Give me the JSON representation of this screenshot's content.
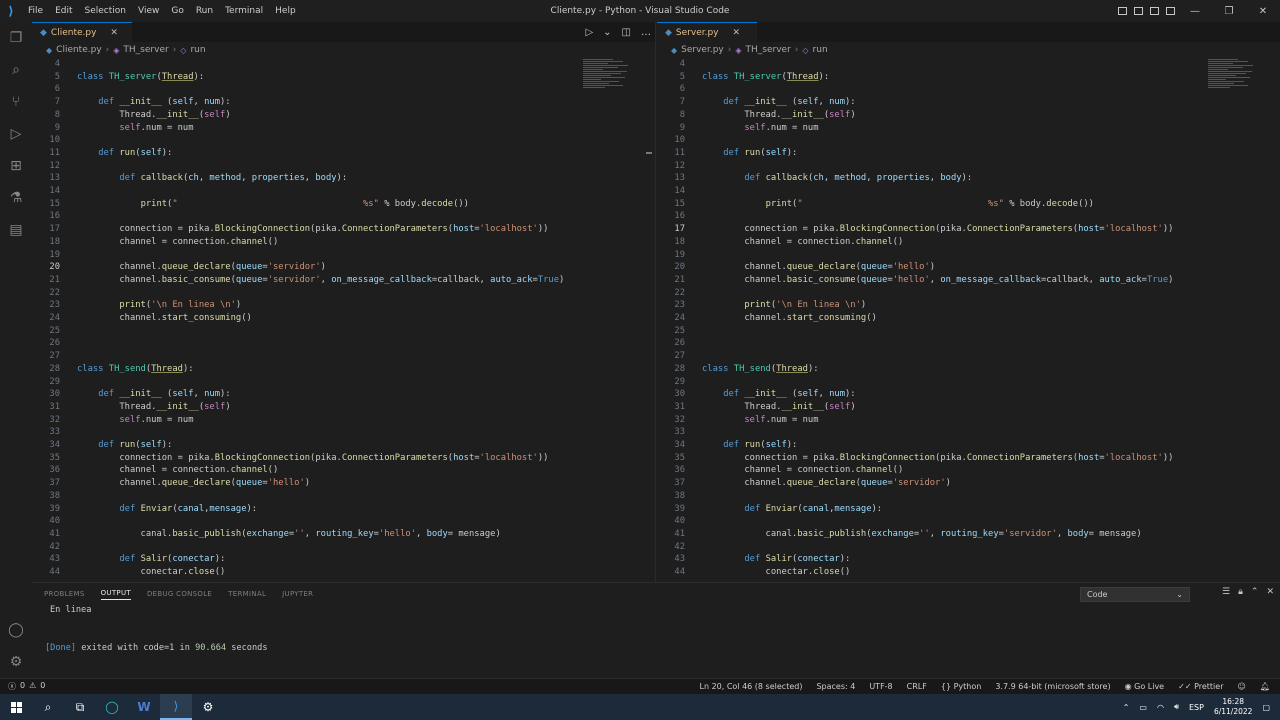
{
  "window": {
    "title": "Cliente.py - Python - Visual Studio Code",
    "menu": [
      "File",
      "Edit",
      "Selection",
      "View",
      "Go",
      "Run",
      "Terminal",
      "Help"
    ]
  },
  "left_editor": {
    "tab": "Cliente.py",
    "breadcrumb": [
      "Cliente.py",
      "TH_server",
      "run"
    ],
    "lines": [
      {
        "n": "4",
        "html": ""
      },
      {
        "n": "5",
        "html": "<span class='kw'>class</span> <span class='cls'>TH_server</span>(<span class='hl-cls'>Thread</span>):"
      },
      {
        "n": "6",
        "html": ""
      },
      {
        "n": "7",
        "html": "    <span class='kw'>def</span> <span class='fn'>__init__</span> (<span class='prm'>self</span>, <span class='prm'>num</span>):"
      },
      {
        "n": "8",
        "html": "        Thread.<span class='fn'>__init__</span>(<span class='slf'>self</span>)"
      },
      {
        "n": "9",
        "html": "        <span class='slf'>self</span>.num = num"
      },
      {
        "n": "10",
        "html": ""
      },
      {
        "n": "11",
        "html": "    <span class='kw'>def</span> <span class='fn'>run</span>(<span class='prm'>self</span>):"
      },
      {
        "n": "12",
        "html": ""
      },
      {
        "n": "13",
        "html": "        <span class='kw'>def</span> <span class='fn'>callback</span>(<span class='prm'>ch</span>, <span class='prm'>method</span>, <span class='prm'>properties</span>, <span class='prm'>body</span>):"
      },
      {
        "n": "14",
        "html": ""
      },
      {
        "n": "15",
        "html": "            <span class='fn'>print</span>(<span class='str'>\"                                   %s\"</span> % body.<span class='fn'>decode</span>())"
      },
      {
        "n": "16",
        "html": ""
      },
      {
        "n": "17",
        "html": "        connection = pika.<span class='fn'>BlockingConnection</span>(pika.<span class='fn'>ConnectionParameters</span>(<span class='prm'>host</span>=<span class='str'>'localhost'</span>))"
      },
      {
        "n": "18",
        "html": "        channel = connection.<span class='fn'>channel</span>()"
      },
      {
        "n": "19",
        "html": ""
      },
      {
        "n": "20",
        "html": "        channel.<span class='fn'>queue_declare</span>(<span class='prm'>queue</span>=<span class='str'>'servidor'</span>)",
        "cur": true
      },
      {
        "n": "21",
        "html": "        channel.<span class='fn'>basic_consume</span>(<span class='prm'>queue</span>=<span class='str'>'servidor'</span>, <span class='prm'>on_message_callback</span>=callback, <span class='prm'>auto_ack</span>=<span class='kw'>True</span>)"
      },
      {
        "n": "22",
        "html": ""
      },
      {
        "n": "23",
        "html": "        <span class='fn'>print</span>(<span class='str'>'\\n En linea \\n'</span>)"
      },
      {
        "n": "24",
        "html": "        channel.<span class='fn'>start_consuming</span>()"
      },
      {
        "n": "25",
        "html": ""
      },
      {
        "n": "26",
        "html": ""
      },
      {
        "n": "27",
        "html": ""
      },
      {
        "n": "28",
        "html": "<span class='kw'>class</span> <span class='cls'>TH_send</span>(<span class='hl-cls'>Thread</span>):"
      },
      {
        "n": "29",
        "html": ""
      },
      {
        "n": "30",
        "html": "    <span class='kw'>def</span> <span class='fn'>__init__</span> (<span class='prm'>self</span>, <span class='prm'>num</span>):"
      },
      {
        "n": "31",
        "html": "        Thread.<span class='fn'>__init__</span>(<span class='slf'>self</span>)"
      },
      {
        "n": "32",
        "html": "        <span class='slf'>self</span>.num = num"
      },
      {
        "n": "33",
        "html": ""
      },
      {
        "n": "34",
        "html": "    <span class='kw'>def</span> <span class='fn'>run</span>(<span class='prm'>self</span>):"
      },
      {
        "n": "35",
        "html": "        connection = pika.<span class='fn'>BlockingConnection</span>(pika.<span class='fn'>ConnectionParameters</span>(<span class='prm'>host</span>=<span class='str'>'localhost'</span>))"
      },
      {
        "n": "36",
        "html": "        channel = connection.<span class='fn'>channel</span>()"
      },
      {
        "n": "37",
        "html": "        channel.<span class='fn'>queue_declare</span>(<span class='prm'>queue</span>=<span class='str'>'hello'</span>)"
      },
      {
        "n": "38",
        "html": ""
      },
      {
        "n": "39",
        "html": "        <span class='kw'>def</span> <span class='fn'>Enviar</span>(<span class='prm'>canal</span>,<span class='prm'>mensage</span>):"
      },
      {
        "n": "40",
        "html": ""
      },
      {
        "n": "41",
        "html": "            canal.<span class='fn'>basic_publish</span>(<span class='prm'>exchange</span>=<span class='str'>''</span>, <span class='prm'>routing_key</span>=<span class='str'>'hello'</span>, <span class='prm'>body</span>= mensage)"
      },
      {
        "n": "42",
        "html": ""
      },
      {
        "n": "43",
        "html": "        <span class='kw'>def</span> <span class='fn'>Salir</span>(<span class='prm'>conectar</span>):"
      },
      {
        "n": "44",
        "html": "            conectar.<span class='fn'>close</span>()"
      }
    ]
  },
  "right_editor": {
    "tab": "Server.py",
    "breadcrumb": [
      "Server.py",
      "TH_server",
      "run"
    ],
    "lines": [
      {
        "n": "4",
        "html": ""
      },
      {
        "n": "5",
        "html": "<span class='kw'>class</span> <span class='cls'>TH_server</span>(<span class='hl-cls'>Thread</span>):"
      },
      {
        "n": "6",
        "html": ""
      },
      {
        "n": "7",
        "html": "    <span class='kw'>def</span> <span class='fn'>__init__</span> (<span class='prm'>self</span>, <span class='prm'>num</span>):"
      },
      {
        "n": "8",
        "html": "        Thread.<span class='fn'>__init__</span>(<span class='slf'>self</span>)"
      },
      {
        "n": "9",
        "html": "        <span class='slf'>self</span>.num = num"
      },
      {
        "n": "10",
        "html": ""
      },
      {
        "n": "11",
        "html": "    <span class='kw'>def</span> <span class='fn'>run</span>(<span class='prm'>self</span>):"
      },
      {
        "n": "12",
        "html": ""
      },
      {
        "n": "13",
        "html": "        <span class='kw'>def</span> <span class='fn'>callback</span>(<span class='prm'>ch</span>, <span class='prm'>method</span>, <span class='prm'>properties</span>, <span class='prm'>body</span>):"
      },
      {
        "n": "14",
        "html": ""
      },
      {
        "n": "15",
        "html": "            <span class='fn'>print</span>(<span class='str'>\"                                   %s\"</span> % body.<span class='fn'>decode</span>())"
      },
      {
        "n": "16",
        "html": ""
      },
      {
        "n": "17",
        "html": "        connection = pika.<span class='fn'>BlockingConnection</span>(pika.<span class='fn'>ConnectionParameters</span>(<span class='prm'>host</span>=<span class='str'>'localhost'</span>))",
        "cur": true
      },
      {
        "n": "18",
        "html": "        channel = connection.<span class='fn'>channel</span>()"
      },
      {
        "n": "19",
        "html": ""
      },
      {
        "n": "20",
        "html": "        channel.<span class='fn'>queue_declare</span>(<span class='prm'>queue</span>=<span class='str'>'hello'</span>)"
      },
      {
        "n": "21",
        "html": "        channel.<span class='fn'>basic_consume</span>(<span class='prm'>queue</span>=<span class='str'>'hello'</span>, <span class='prm'>on_message_callback</span>=callback, <span class='prm'>auto_ack</span>=<span class='kw'>True</span>)"
      },
      {
        "n": "22",
        "html": ""
      },
      {
        "n": "23",
        "html": "        <span class='fn'>print</span>(<span class='str'>'\\n En linea \\n'</span>)"
      },
      {
        "n": "24",
        "html": "        channel.<span class='fn'>start_consuming</span>()"
      },
      {
        "n": "25",
        "html": ""
      },
      {
        "n": "26",
        "html": ""
      },
      {
        "n": "27",
        "html": ""
      },
      {
        "n": "28",
        "html": "<span class='kw'>class</span> <span class='cls'>TH_send</span>(<span class='hl-cls'>Thread</span>):"
      },
      {
        "n": "29",
        "html": ""
      },
      {
        "n": "30",
        "html": "    <span class='kw'>def</span> <span class='fn'>__init__</span> (<span class='prm'>self</span>, <span class='prm'>num</span>):"
      },
      {
        "n": "31",
        "html": "        Thread.<span class='fn'>__init__</span>(<span class='slf'>self</span>)"
      },
      {
        "n": "32",
        "html": "        <span class='slf'>self</span>.num = num"
      },
      {
        "n": "33",
        "html": ""
      },
      {
        "n": "34",
        "html": "    <span class='kw'>def</span> <span class='fn'>run</span>(<span class='prm'>self</span>):"
      },
      {
        "n": "35",
        "html": "        connection = pika.<span class='fn'>BlockingConnection</span>(pika.<span class='fn'>ConnectionParameters</span>(<span class='prm'>host</span>=<span class='str'>'localhost'</span>))"
      },
      {
        "n": "36",
        "html": "        channel = connection.<span class='fn'>channel</span>()"
      },
      {
        "n": "37",
        "html": "        channel.<span class='fn'>queue_declare</span>(<span class='prm'>queue</span>=<span class='str'>'servidor'</span>)"
      },
      {
        "n": "38",
        "html": ""
      },
      {
        "n": "39",
        "html": "        <span class='kw'>def</span> <span class='fn'>Enviar</span>(<span class='prm'>canal</span>,<span class='prm'>mensage</span>):"
      },
      {
        "n": "40",
        "html": ""
      },
      {
        "n": "41",
        "html": "            canal.<span class='fn'>basic_publish</span>(<span class='prm'>exchange</span>=<span class='str'>''</span>, <span class='prm'>routing_key</span>=<span class='str'>'servidor'</span>, <span class='prm'>body</span>= mensage)"
      },
      {
        "n": "42",
        "html": ""
      },
      {
        "n": "43",
        "html": "        <span class='kw'>def</span> <span class='fn'>Salir</span>(<span class='prm'>conectar</span>):"
      },
      {
        "n": "44",
        "html": "            conectar.<span class='fn'>close</span>()"
      }
    ]
  },
  "panel": {
    "tabs": [
      "PROBLEMS",
      "OUTPUT",
      "DEBUG CONSOLE",
      "TERMINAL",
      "JUPYTER"
    ],
    "active_tab": "OUTPUT",
    "selected_channel": "Code",
    "output_line1": "En linea",
    "output_done": "[Done]",
    "output_mid": " exited with ",
    "output_code": "code=1",
    "output_in": " in ",
    "output_secs": "90.664",
    "output_tail": " seconds"
  },
  "status": {
    "errors": "0",
    "warnings": "0",
    "position": "Ln 20, Col 46 (8 selected)",
    "spaces": "Spaces: 4",
    "encoding": "UTF-8",
    "eol": "CRLF",
    "language": "Python",
    "interpreter": "3.7.9 64-bit (microsoft store)",
    "golive": "Go Live",
    "prettier": "Prettier"
  },
  "taskbar": {
    "lang": "ESP",
    "time": "16:28",
    "date": "6/11/2022"
  }
}
